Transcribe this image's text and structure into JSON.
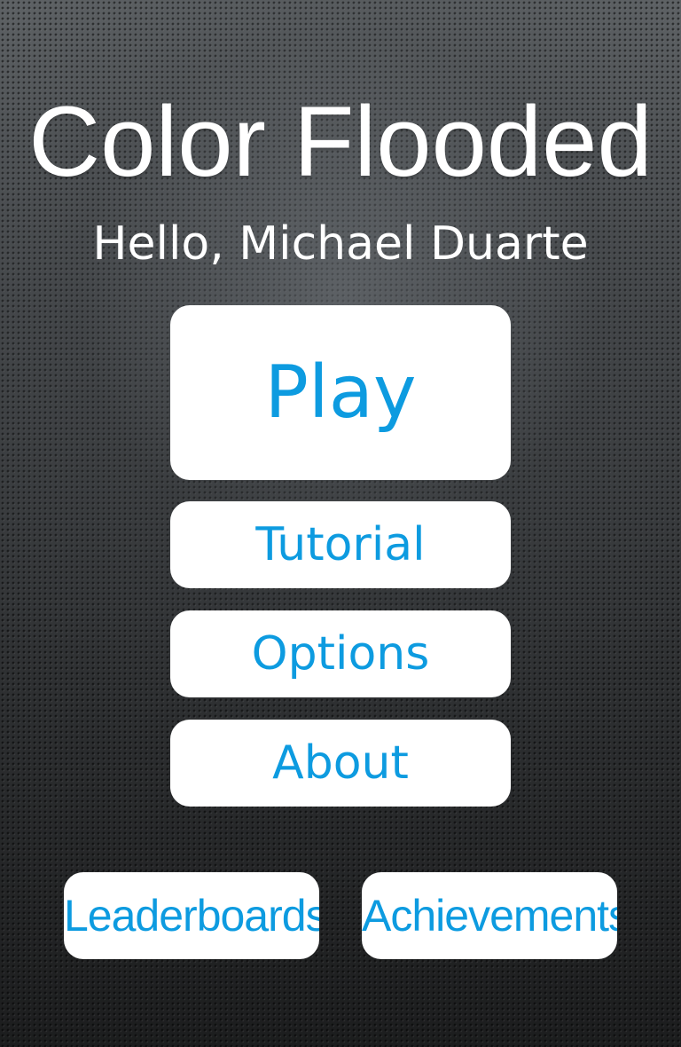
{
  "app": {
    "title": "Color Flooded",
    "greeting": "Hello, Michael Duarte"
  },
  "menu": {
    "play_label": "Play",
    "tutorial_label": "Tutorial",
    "options_label": "Options",
    "about_label": "About"
  },
  "games": {
    "leaderboards_label": "Leaderboards",
    "achievements_label": "Achievements"
  },
  "colors": {
    "button_text": "#0d9be0",
    "button_background": "#ffffff",
    "title_text": "#ffffff",
    "background": "#2a2c2e"
  }
}
